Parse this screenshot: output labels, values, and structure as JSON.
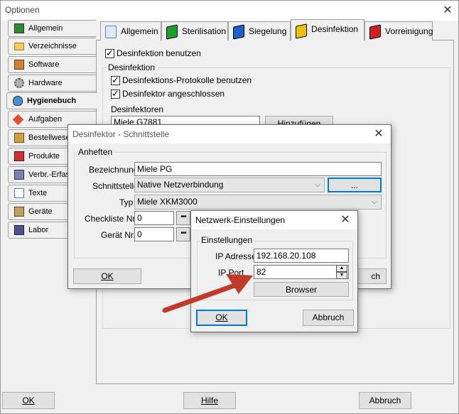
{
  "window": {
    "title": "Optionen",
    "close": "✕"
  },
  "sidebar": {
    "items": [
      {
        "label": "Allgemein",
        "icon": "green-book-icon",
        "color": "#2e8b2e"
      },
      {
        "label": "Verzeichnisse",
        "icon": "folder-icon",
        "color": "#e0b040"
      },
      {
        "label": "Software",
        "icon": "software-icon",
        "color": "#c07020"
      },
      {
        "label": "Hardware",
        "icon": "gear-icon",
        "color": "#808080"
      },
      {
        "label": "Hygienebuch",
        "icon": "hygiene-icon",
        "color": "#3070c0"
      },
      {
        "label": "Aufgaben",
        "icon": "tasks-icon",
        "color": "#d04020"
      },
      {
        "label": "Bestellwese",
        "icon": "order-icon",
        "color": "#c09030"
      },
      {
        "label": "Produkte",
        "icon": "products-icon",
        "color": "#c03030"
      },
      {
        "label": "Verbr.-Erfas",
        "icon": "consumption-icon",
        "color": "#606090"
      },
      {
        "label": "Texte",
        "icon": "text-icon",
        "color": "#6080c0"
      },
      {
        "label": "Geräte",
        "icon": "devices-icon",
        "color": "#a08040"
      },
      {
        "label": "Labor",
        "icon": "lab-icon",
        "color": "#404080"
      }
    ],
    "active_index": 4
  },
  "tabs": [
    {
      "label": "Allgemein",
      "icon": "document-icon",
      "color": "#7fa7d8"
    },
    {
      "label": "Sterilisation",
      "icon": "green-book-icon",
      "color": "#1aa02a"
    },
    {
      "label": "Siegelung",
      "icon": "blue-book-icon",
      "color": "#1e5fd0"
    },
    {
      "label": "Desinfektion",
      "icon": "yellow-book-icon",
      "color": "#f0c000"
    },
    {
      "label": "Vorreinigung",
      "icon": "red-book-icon",
      "color": "#d02020"
    }
  ],
  "desinfektion": {
    "use_label": "Desinfektion benutzen",
    "group_title": "Desinfektion",
    "protocol_label": "Desinfektions-Protokolle benutzen",
    "connected_label": "Desinfektor angeschlossen",
    "list_title": "Desinfektoren",
    "list_item": "Miele G7881",
    "add_button": "Hinzufügen"
  },
  "footer": {
    "ok": "OK",
    "help": "Hilfe",
    "cancel": "Abbruch"
  },
  "interface_dialog": {
    "title": "Desinfektor - Schnittstelle",
    "group_title": "Anheften",
    "name_label": "Bezeichnung",
    "name_value": "Miele PG",
    "interface_label": "Schnittstelle",
    "interface_value": "Native Netzverbindung",
    "dots_button": "...",
    "type_label": "Typ",
    "type_value": "Miele XKM3000",
    "checklist_label": "Checkliste Nr.",
    "checklist_value": "0",
    "device_label": "Gerät Nr.",
    "device_value": "0",
    "ok": "OK",
    "cancel_partial": "ch"
  },
  "network_dialog": {
    "title": "Netzwerk-Einstellungen",
    "group_title": "Einstellungen",
    "ip_label": "IP Adresse",
    "ip_value": "192.168.20.108",
    "port_label": "IP Port",
    "port_value": "82",
    "browser_button": "Browser",
    "ok": "OK",
    "cancel": "Abbruch"
  },
  "annotation": {
    "arrow_color": "#c0392b"
  }
}
